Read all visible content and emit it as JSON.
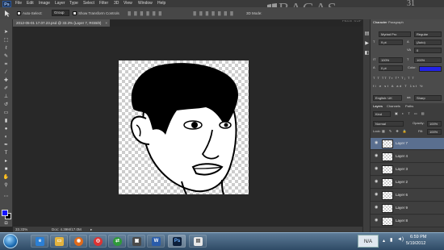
{
  "app": {
    "logo": "Ps",
    "menu": [
      "File",
      "Edit",
      "Image",
      "Layer",
      "Type",
      "Select",
      "Filter",
      "3D",
      "View",
      "Window",
      "Help"
    ]
  },
  "watermark": {
    "text": "BAGAS",
    "sup": "31",
    "sub": "PAGE SOFTWARE INDONESIA"
  },
  "options": {
    "auto_select_label": "Auto-Select:",
    "auto_select_value": "Group",
    "show_transform_label": "Show Transform Controls",
    "mode_3d_label": "3D Mode:"
  },
  "document": {
    "tab_title": "2012-05-01 17.07.23.psd @ 33.3% (Layer 7, RGB/8)",
    "close": "×"
  },
  "status": {
    "zoom": "33.33%",
    "doc_size": "Doc: 4.39M/17.0M"
  },
  "character": {
    "tab1": "Character",
    "tab2": "Paragraph",
    "font_family": "Myriad Pro",
    "font_style": "Regular",
    "size": "9 pt",
    "leading": "(Auto)",
    "tracking": "0",
    "scale_v": "100%",
    "scale_h": "100%",
    "baseline": "0 pt",
    "color_label": "Color:",
    "language": "English: UK",
    "aa": "Sharp",
    "color": "#2323e6"
  },
  "layers_panel": {
    "tabs": [
      "Layers",
      "Channels",
      "Paths"
    ],
    "kind": "Kind",
    "blend": "Normal",
    "opacity_label": "Opacity:",
    "opacity": "100%",
    "lock_label": "Lock:",
    "fill_label": "Fill:",
    "fill": "100%",
    "layers": [
      {
        "name": "Layer 7",
        "selected": true
      },
      {
        "name": "Layer 4",
        "selected": false
      },
      {
        "name": "Layer 3",
        "selected": false
      },
      {
        "name": "Layer 2",
        "selected": false
      },
      {
        "name": "Layer 6",
        "selected": false
      },
      {
        "name": "Layer 9",
        "selected": false
      },
      {
        "name": "Layer 8",
        "selected": false
      }
    ]
  },
  "taskbar": {
    "lang": "N/A",
    "time": "6:59 PM",
    "date": "5/19/2012"
  }
}
